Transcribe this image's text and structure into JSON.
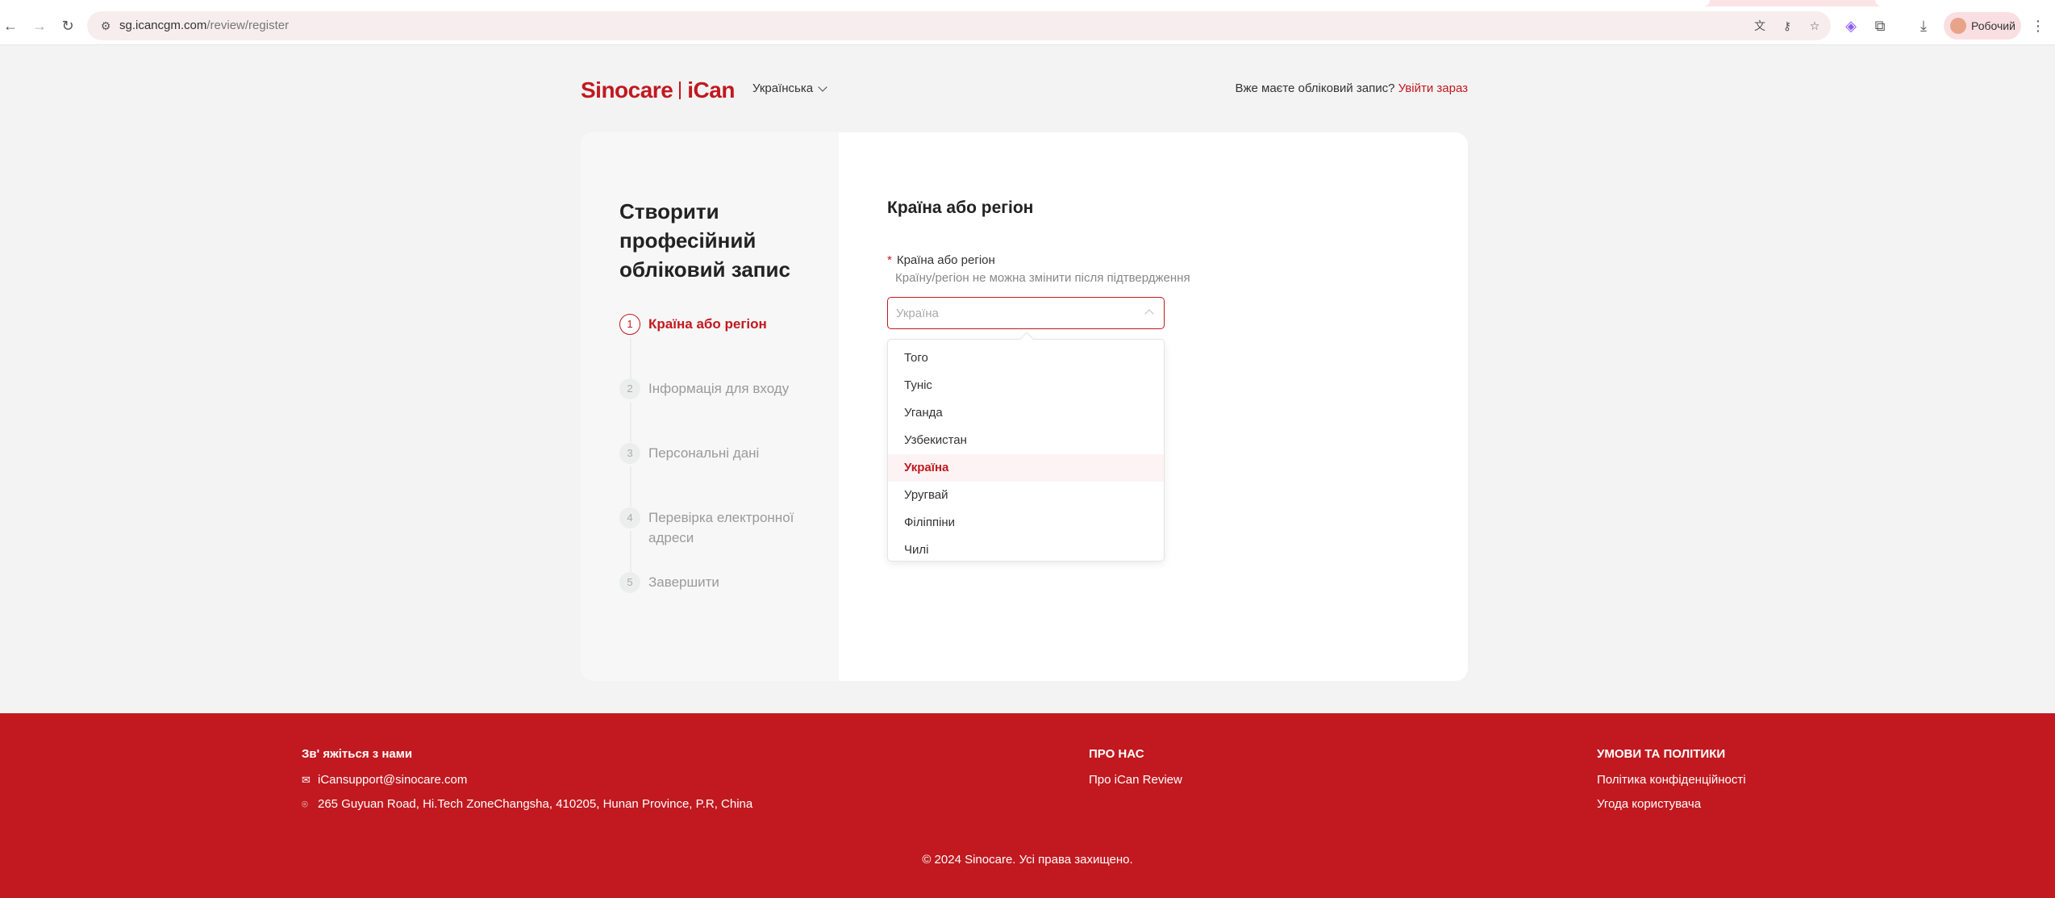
{
  "browser": {
    "url_host": "sg.icancgm.com",
    "url_path": "/review/register",
    "profile_label": "Робочий"
  },
  "header": {
    "logo_brand": "Sinocare",
    "logo_product": "iCan",
    "language": "Українська",
    "have_account": "Вже маєте обліковий запис?",
    "login_link": "Увійти зараз"
  },
  "sidebar": {
    "title": "Створити професійний обліковий запис",
    "steps": [
      {
        "num": "1",
        "label": "Країна або регіон"
      },
      {
        "num": "2",
        "label": "Інформація для входу"
      },
      {
        "num": "3",
        "label": "Персональні дані"
      },
      {
        "num": "4",
        "label": "Перевірка електронної адреси"
      },
      {
        "num": "5",
        "label": "Завершити"
      }
    ]
  },
  "form": {
    "section_title": "Країна або регіон",
    "field_label": "Країна або регіон",
    "required_mark": "*",
    "field_hint": "Країну/регіон не можна змінити після підтвердження",
    "select_placeholder": "Україна",
    "options": [
      "Того",
      "Туніс",
      "Уганда",
      "Узбекистан",
      "Україна",
      "Уругвай",
      "Філіппіни",
      "Чилі"
    ],
    "selected_option": "Україна"
  },
  "footer": {
    "contact_heading": "Зв' яжіться з нами",
    "email": "iCansupport@sinocare.com",
    "address": "265 Guyuan Road, Hi.Tech ZoneChangsha, 410205, Hunan Province, P.R, China",
    "about_heading": "ПРО НАС",
    "about_link": "Про iCan Review",
    "terms_heading": "УМОВИ ТА ПОЛІТИКИ",
    "privacy_link": "Політика конфіденційності",
    "user_agreement_link": "Угода користувача",
    "copyright": "© 2024 Sinocare. Усі права захищено."
  },
  "colors": {
    "brand_red": "#c1191f",
    "page_bg": "#f3f3f3"
  }
}
